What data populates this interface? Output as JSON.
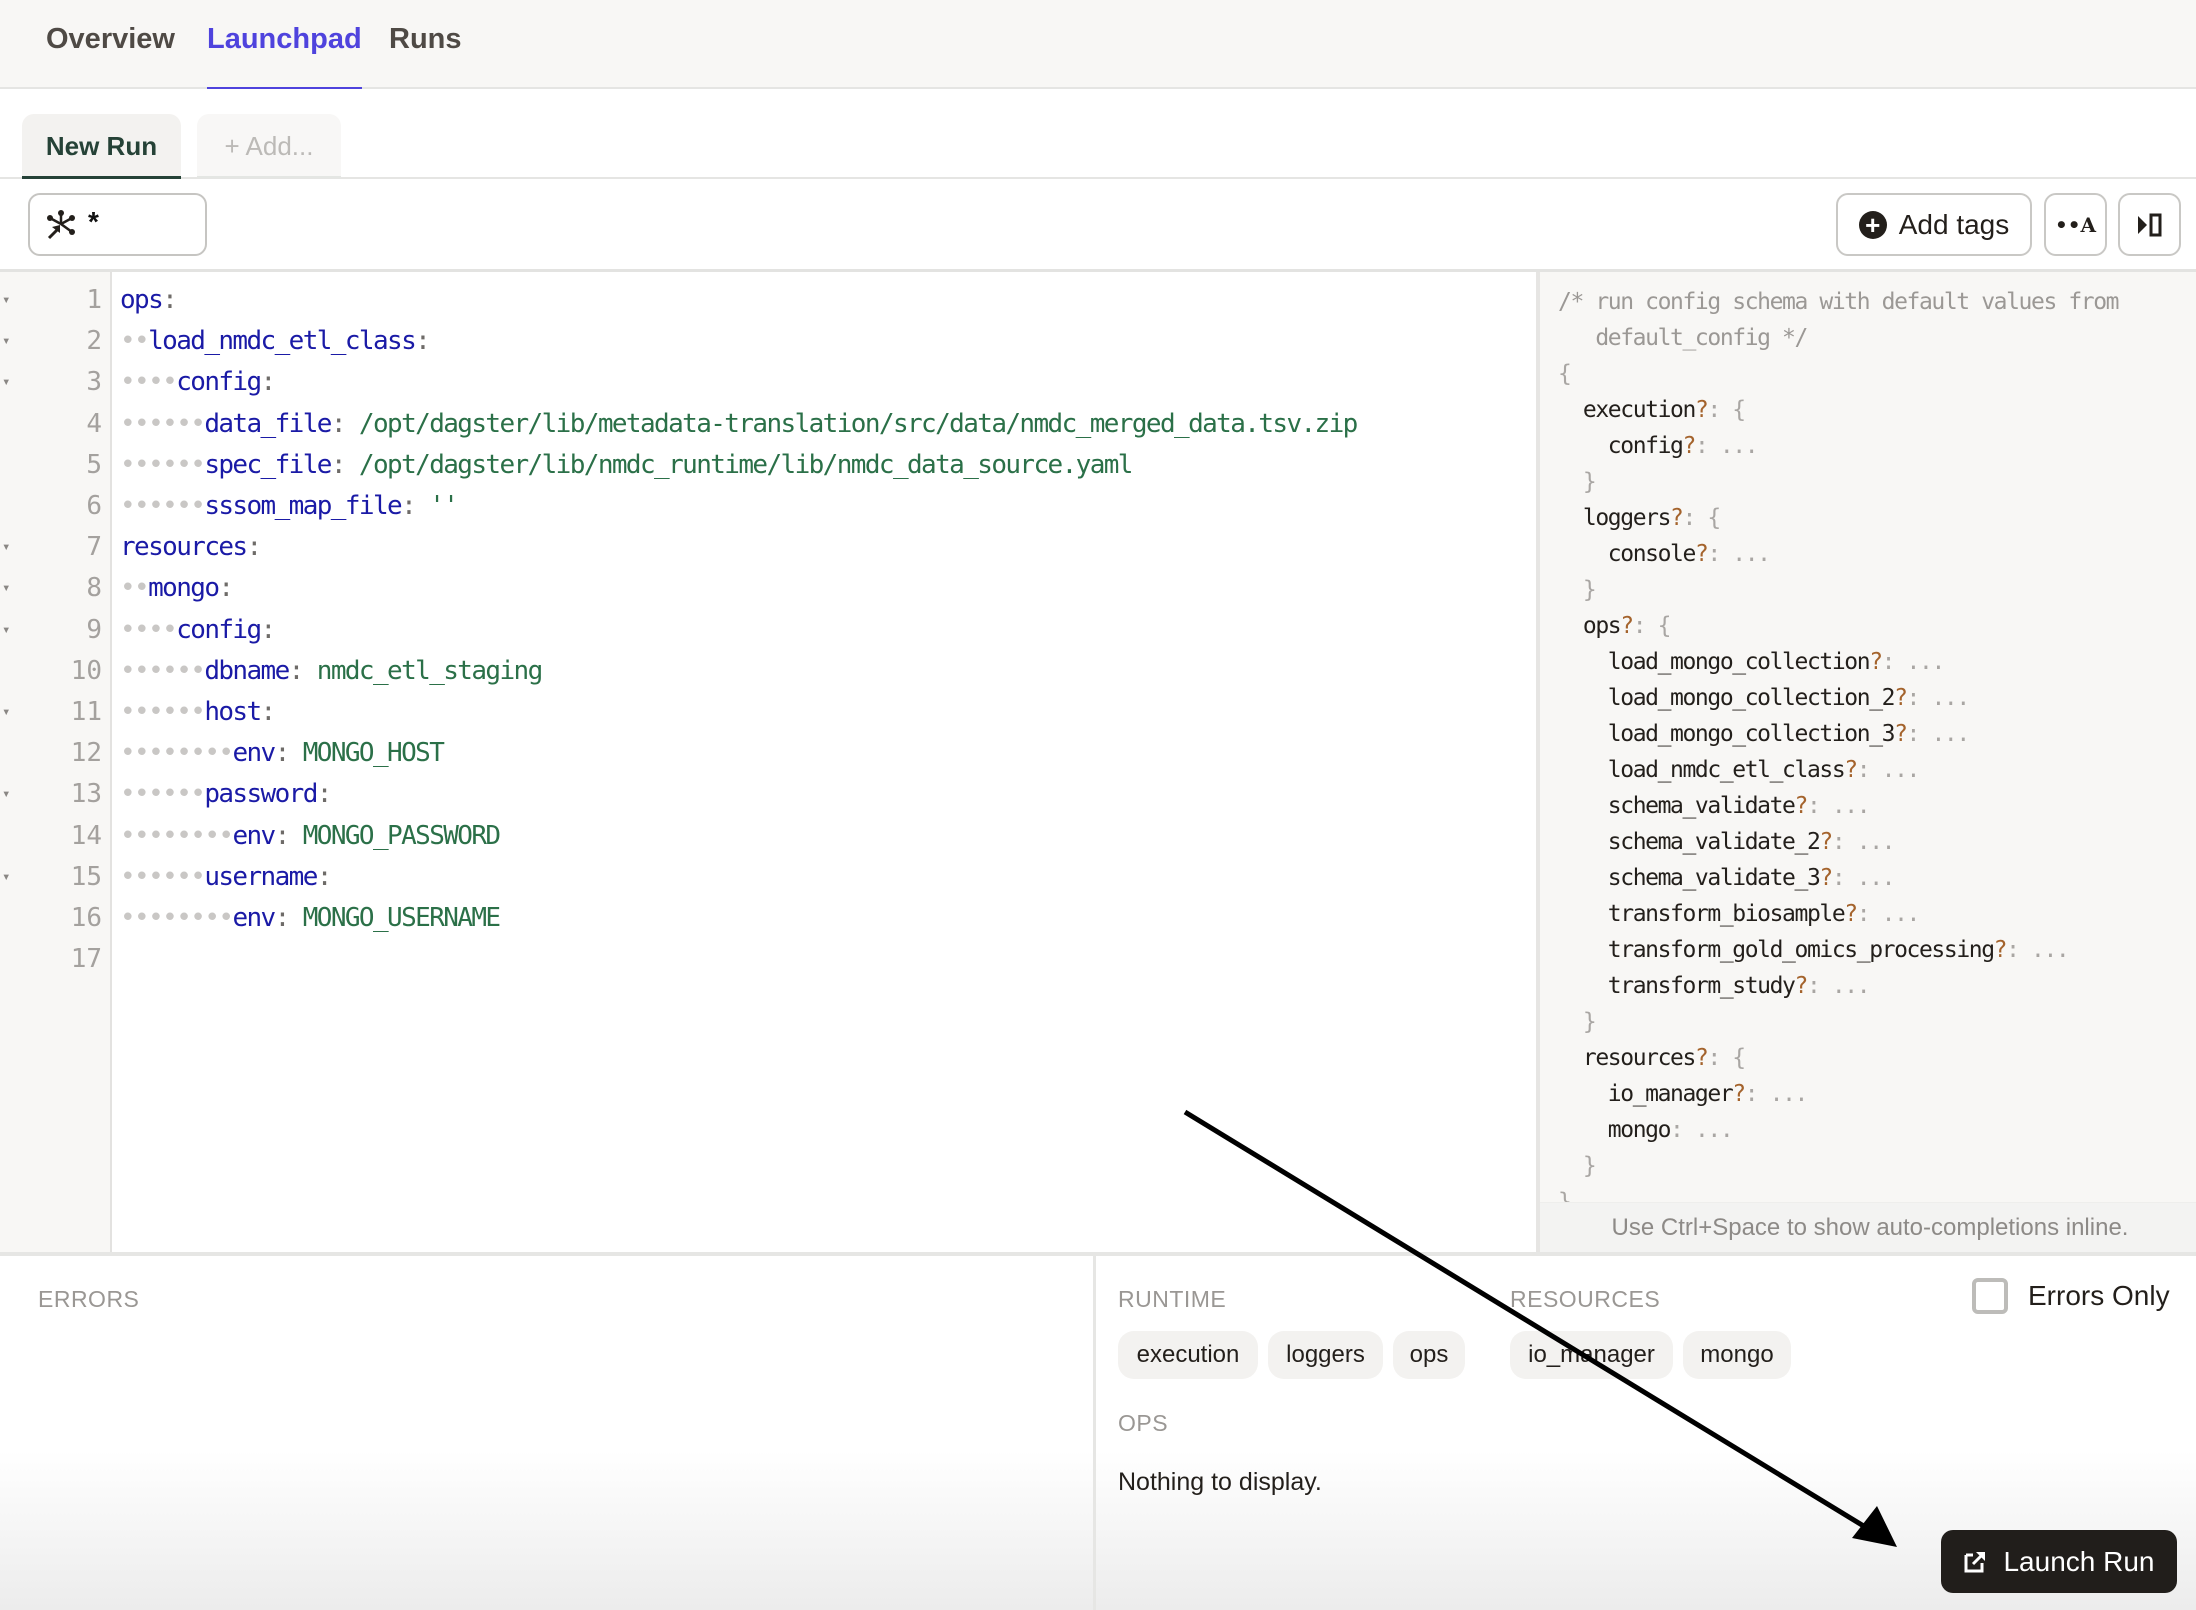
{
  "nav": {
    "tabs": [
      {
        "label": "Overview",
        "active": false
      },
      {
        "label": "Launchpad",
        "active": true
      },
      {
        "label": "Runs",
        "active": false
      }
    ],
    "accent_color": "#4f43dd"
  },
  "run_tabs": {
    "active_label": "New Run",
    "add_label": "+ Add..."
  },
  "toolbar": {
    "op_selector": {
      "icon": "op-selection-icon",
      "value": "*"
    },
    "add_tags_label": "Add tags",
    "add_tags_icon": "plus-circle-icon",
    "whitespace_toggle_icon": "whitespace-icon",
    "whitespace_toggle_text": "••A",
    "panel_toggle_icon": "panel-toggle-icon"
  },
  "editor": {
    "lines": [
      {
        "n": "1",
        "fold": true,
        "indent": "",
        "key": "ops",
        "sep": ":",
        "value": ""
      },
      {
        "n": "2",
        "fold": true,
        "indent": "••",
        "key": "load_nmdc_etl_class",
        "sep": ":",
        "value": ""
      },
      {
        "n": "3",
        "fold": true,
        "indent": "••••",
        "key": "config",
        "sep": ":",
        "value": ""
      },
      {
        "n": "4",
        "fold": false,
        "indent": "••••••",
        "key": "data_file",
        "sep": ": ",
        "value": "/opt/dagster/lib/metadata-translation/src/data/nmdc_merged_data.tsv.zip"
      },
      {
        "n": "5",
        "fold": false,
        "indent": "••••••",
        "key": "spec_file",
        "sep": ": ",
        "value": "/opt/dagster/lib/nmdc_runtime/lib/nmdc_data_source.yaml"
      },
      {
        "n": "6",
        "fold": false,
        "indent": "••••••",
        "key": "sssom_map_file",
        "sep": ": ",
        "value": "''"
      },
      {
        "n": "7",
        "fold": true,
        "indent": "",
        "key": "resources",
        "sep": ":",
        "value": ""
      },
      {
        "n": "8",
        "fold": true,
        "indent": "••",
        "key": "mongo",
        "sep": ":",
        "value": ""
      },
      {
        "n": "9",
        "fold": true,
        "indent": "••••",
        "key": "config",
        "sep": ":",
        "value": ""
      },
      {
        "n": "10",
        "fold": false,
        "indent": "••••••",
        "key": "dbname",
        "sep": ": ",
        "value": "nmdc_etl_staging"
      },
      {
        "n": "11",
        "fold": true,
        "indent": "••••••",
        "key": "host",
        "sep": ":",
        "value": ""
      },
      {
        "n": "12",
        "fold": false,
        "indent": "••••••••",
        "key": "env",
        "sep": ": ",
        "value": "MONGO_HOST"
      },
      {
        "n": "13",
        "fold": true,
        "indent": "••••••",
        "key": "password",
        "sep": ":",
        "value": ""
      },
      {
        "n": "14",
        "fold": false,
        "indent": "••••••••",
        "key": "env",
        "sep": ": ",
        "value": "MONGO_PASSWORD"
      },
      {
        "n": "15",
        "fold": true,
        "indent": "••••••",
        "key": "username",
        "sep": ":",
        "value": ""
      },
      {
        "n": "16",
        "fold": false,
        "indent": "••••••••",
        "key": "env",
        "sep": ": ",
        "value": "MONGO_USERNAME"
      },
      {
        "n": "17",
        "fold": false,
        "indent": "",
        "key": "",
        "sep": "",
        "value": ""
      }
    ]
  },
  "schema": {
    "comment_line1": "/* run config schema with default values from",
    "comment_line2": "   default_config */",
    "lines": [
      {
        "indent": "",
        "name": "{",
        "optional": false,
        "tail": ""
      },
      {
        "indent": "  ",
        "name": "execution",
        "optional": true,
        "tail": ": {"
      },
      {
        "indent": "    ",
        "name": "config",
        "optional": true,
        "tail": ": ..."
      },
      {
        "indent": "  ",
        "name": "}",
        "optional": false,
        "tail": ""
      },
      {
        "indent": "  ",
        "name": "loggers",
        "optional": true,
        "tail": ": {"
      },
      {
        "indent": "    ",
        "name": "console",
        "optional": true,
        "tail": ": ..."
      },
      {
        "indent": "  ",
        "name": "}",
        "optional": false,
        "tail": ""
      },
      {
        "indent": "  ",
        "name": "ops",
        "optional": true,
        "tail": ": {"
      },
      {
        "indent": "    ",
        "name": "load_mongo_collection",
        "optional": true,
        "tail": ": ..."
      },
      {
        "indent": "    ",
        "name": "load_mongo_collection_2",
        "optional": true,
        "tail": ": ..."
      },
      {
        "indent": "    ",
        "name": "load_mongo_collection_3",
        "optional": true,
        "tail": ": ..."
      },
      {
        "indent": "    ",
        "name": "load_nmdc_etl_class",
        "optional": true,
        "tail": ": ..."
      },
      {
        "indent": "    ",
        "name": "schema_validate",
        "optional": true,
        "tail": ": ..."
      },
      {
        "indent": "    ",
        "name": "schema_validate_2",
        "optional": true,
        "tail": ": ..."
      },
      {
        "indent": "    ",
        "name": "schema_validate_3",
        "optional": true,
        "tail": ": ..."
      },
      {
        "indent": "    ",
        "name": "transform_biosample",
        "optional": true,
        "tail": ": ..."
      },
      {
        "indent": "    ",
        "name": "transform_gold_omics_processing",
        "optional": true,
        "tail": ": ..."
      },
      {
        "indent": "    ",
        "name": "transform_study",
        "optional": true,
        "tail": ": ..."
      },
      {
        "indent": "  ",
        "name": "}",
        "optional": false,
        "tail": ""
      },
      {
        "indent": "  ",
        "name": "resources",
        "optional": true,
        "tail": ": {"
      },
      {
        "indent": "    ",
        "name": "io_manager",
        "optional": true,
        "tail": ": ..."
      },
      {
        "indent": "    ",
        "name": "mongo",
        "optional": false,
        "tail": ": ..."
      },
      {
        "indent": "  ",
        "name": "}",
        "optional": false,
        "tail": ""
      },
      {
        "indent": "",
        "name": "}",
        "optional": false,
        "tail": ""
      }
    ],
    "hint": "Use Ctrl+Space to show auto-completions inline."
  },
  "bottom": {
    "errors_label": "ERRORS",
    "runtime_label": "RUNTIME",
    "resources_label": "RESOURCES",
    "ops_label": "OPS",
    "runtime_chips": [
      "execution",
      "loggers",
      "ops"
    ],
    "resource_chips": [
      "io_manager",
      "mongo"
    ],
    "ops_empty": "Nothing to display.",
    "errors_only_label": "Errors Only",
    "errors_only_checked": false,
    "launch_label": "Launch Run",
    "launch_icon": "open-in-new-icon"
  },
  "annotation": {
    "type": "arrow",
    "points_to": "launch-run-button",
    "color": "#000000"
  }
}
